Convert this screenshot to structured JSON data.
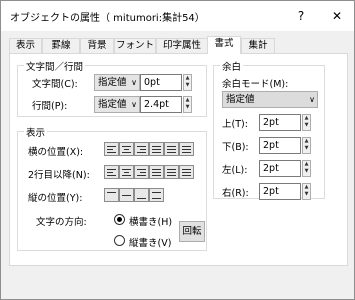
{
  "window": {
    "title": "オブジェクトの属性（ mitumori:集計54）",
    "help_label": "?",
    "close_label": "✕"
  },
  "tabs": [
    {
      "label": "表示"
    },
    {
      "label": "罫線"
    },
    {
      "label": "背景"
    },
    {
      "label": "フォント"
    },
    {
      "label": "印字属性"
    },
    {
      "label": "書式",
      "active": true
    },
    {
      "label": "集計"
    }
  ],
  "spacing": {
    "group_title": "文字間／行間",
    "char_spacing": {
      "label": "文字間(C):",
      "mode": "指定値",
      "value": "0pt"
    },
    "line_spacing": {
      "label": "行間(P):",
      "mode": "指定値",
      "value": "2.4pt"
    }
  },
  "display": {
    "group_title": "表示",
    "h_position_label": "横の位置(X):",
    "second_line_label": "2行目以降(N):",
    "v_position_label": "縦の位置(Y):",
    "direction_label": "文字の方向:",
    "horizontal_label": "横書き(H)",
    "vertical_label": "縦書き(V)",
    "horizontal_selected": true,
    "rotate_button": "回転"
  },
  "margin": {
    "group_title": "余白",
    "mode_label": "余白モード(M):",
    "mode_value": "指定値",
    "top": {
      "label": "上(T):",
      "value": "2pt"
    },
    "bottom": {
      "label": "下(B):",
      "value": "2pt"
    },
    "left": {
      "label": "左(L):",
      "value": "2pt"
    },
    "right": {
      "label": "右(R):",
      "value": "2pt"
    }
  }
}
